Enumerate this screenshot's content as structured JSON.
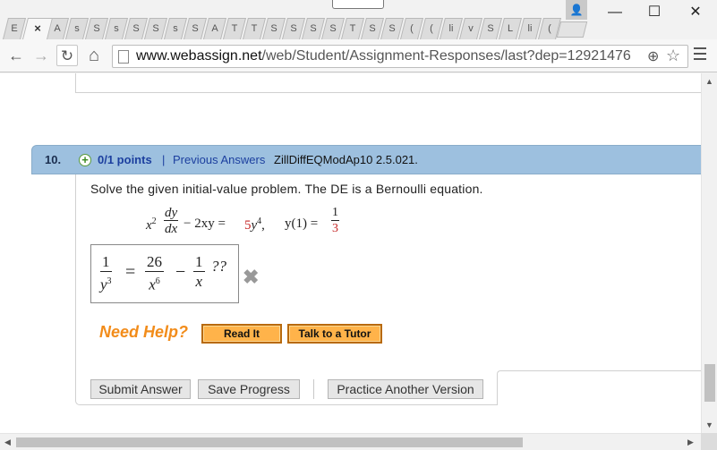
{
  "browser": {
    "tabs": [
      "E",
      "×",
      "A",
      "s",
      "S",
      "s",
      "S",
      "S",
      "s",
      "S",
      "A",
      "T",
      "T",
      "S",
      "S",
      "S",
      "S",
      "T",
      "S",
      "S",
      "(",
      "(",
      "li",
      "v",
      "S",
      "L",
      "li",
      "("
    ],
    "url_domain": "www.webassign.net",
    "url_path": "/web/Student/Assignment-Responses/last?dep=12921476",
    "minimize_label": "—",
    "maximize_label": "☐",
    "close_label": "✕",
    "back_label": "←",
    "forward_label": "→",
    "reload_label": "↻",
    "home_label": "⌂",
    "zoom_label": "⊕",
    "star_label": "☆",
    "user_label": "👤"
  },
  "question": {
    "number": "10.",
    "points": "0/1 points",
    "separator": "|",
    "previous_answers": "Previous Answers",
    "code": "ZillDiffEQModAp10 2.5.021.",
    "prompt": "Solve the given initial-value problem. The DE is a Bernoulli equation.",
    "equation": {
      "lhs_x": "x",
      "lhs_exp": "2",
      "frac_num": "dy",
      "frac_den": "dx",
      "middle": " − 2xy = ",
      "coef": "5",
      "rhs_y": "y",
      "rhs_exp": "4",
      "comma": ",",
      "ic_left": "y(1) = ",
      "ic_num": "1",
      "ic_den": "3"
    },
    "answer": {
      "f1_num": "1",
      "f1_den_base": "y",
      "f1_den_exp": "3",
      "equals": "=",
      "f2_num": "26",
      "f2_den_base": "x",
      "f2_den_exp": "6",
      "minus": "−",
      "f3_num": "1",
      "f3_den": "x",
      "trailing": "??"
    },
    "status_icon": "✖",
    "need_help": "Need Help?",
    "read_it": "Read It",
    "talk_to_tutor": "Talk to a Tutor",
    "submit": "Submit Answer",
    "save": "Save Progress",
    "practice": "Practice Another Version"
  }
}
